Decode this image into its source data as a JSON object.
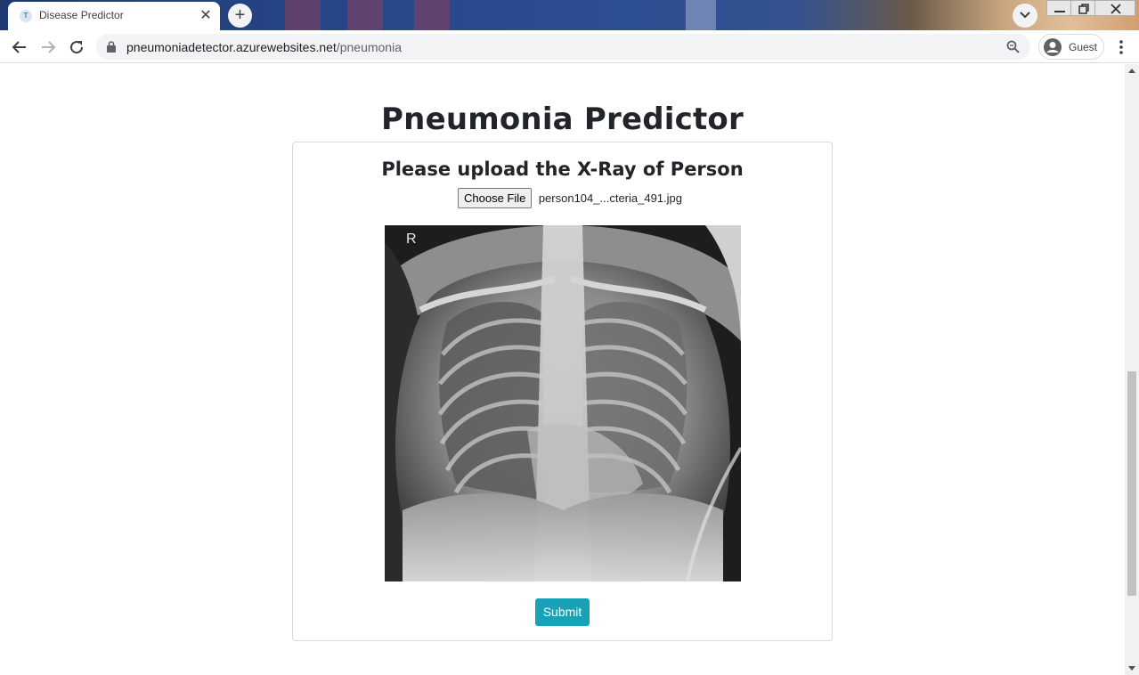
{
  "browser": {
    "tab_title": "Disease Predictor",
    "tab_close": "✕",
    "new_tab": "+",
    "url_host": "pneumoniadetector.azurewebsites.net",
    "url_path": "/pneumonia",
    "profile_name": "Guest"
  },
  "page": {
    "title": "Pneumonia Predictor",
    "card_heading": "Please upload the X-Ray of Person",
    "choose_file_label": "Choose File",
    "file_name": "person104_...cteria_491.jpg",
    "xray_marker": "R",
    "submit_label": "Submit"
  },
  "colors": {
    "submit_button": "#17a2b8",
    "heading_text": "#212529"
  },
  "icons": [
    "back-arrow-icon",
    "forward-arrow-icon",
    "reload-icon",
    "lock-icon",
    "zoom-icon",
    "profile-avatar-icon",
    "kebab-menu-icon",
    "tab-search-icon",
    "minimize-icon",
    "restore-icon",
    "close-window-icon"
  ]
}
